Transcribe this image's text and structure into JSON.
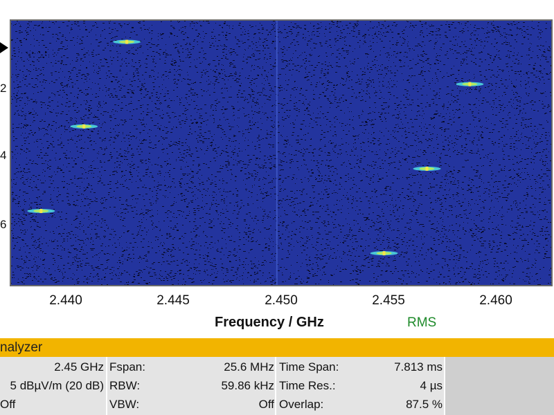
{
  "spectrogram": {
    "y_ticks": [
      "2",
      "4",
      "6"
    ],
    "x_ticks": [
      "2.440",
      "2.445",
      "2.450",
      "2.455",
      "2.460"
    ],
    "x_axis_label": "Frequency / GHz",
    "detector_label": "RMS",
    "background_color": "#23349e",
    "signal_color": "#f4e64a",
    "x_range_ghz": [
      2.4376,
      2.4628
    ],
    "bursts": [
      {
        "freq_ghz": 2.443,
        "row": 0.08
      },
      {
        "freq_ghz": 2.441,
        "row": 0.4
      },
      {
        "freq_ghz": 2.439,
        "row": 0.72
      },
      {
        "freq_ghz": 2.459,
        "row": 0.24
      },
      {
        "freq_ghz": 2.457,
        "row": 0.56
      },
      {
        "freq_ghz": 2.455,
        "row": 0.88
      }
    ]
  },
  "analyzer_panel": {
    "title": "nalyzer",
    "col1": {
      "rows": [
        "2.45 GHz",
        "5 dBµV/m (20 dB)",
        "Off"
      ]
    },
    "col2": {
      "labels": [
        "Fspan:",
        "RBW:",
        "VBW:"
      ],
      "values": [
        "25.6 MHz",
        "59.86 kHz",
        "Off"
      ]
    },
    "col3": {
      "labels": [
        "Time Span:",
        "Time Res.:",
        "Overlap:"
      ],
      "values": [
        "7.813 ms",
        "4 µs",
        "87.5 %"
      ]
    }
  }
}
